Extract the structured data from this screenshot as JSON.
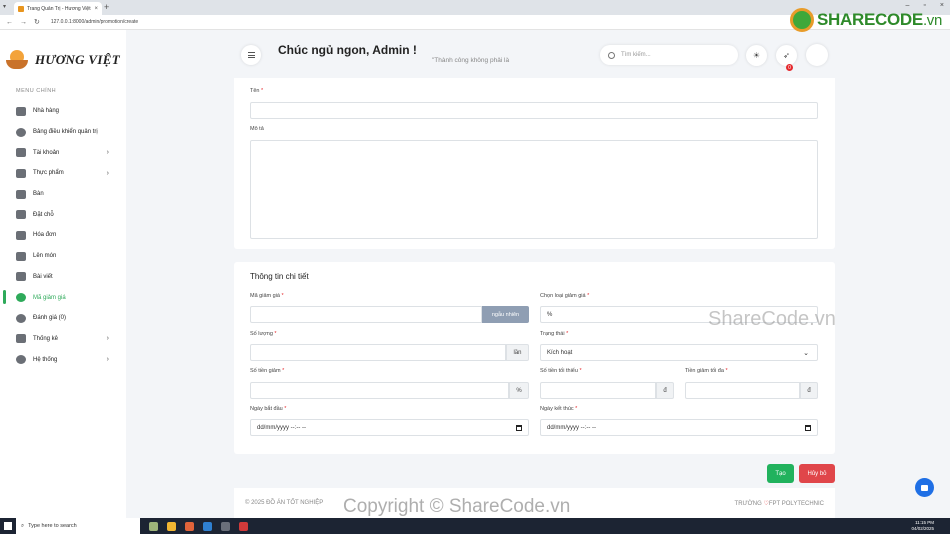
{
  "browser": {
    "tab_title": "Trang Quản Trị - Hương Việt",
    "url": "127.0.0.1:8000/admin/promotion/create"
  },
  "sidebar": {
    "logo_text": "HƯƠNG VIỆT",
    "menu_title": "MENU CHÍNH",
    "items": [
      {
        "label": "Nhà hàng",
        "icon": "store-icon"
      },
      {
        "label": "Bảng điều khiển quản trị",
        "icon": "dashboard-icon"
      },
      {
        "label": "Tài khoản",
        "icon": "users-icon",
        "has_children": true
      },
      {
        "label": "Thực phẩm",
        "icon": "utensils-icon",
        "has_children": true
      },
      {
        "label": "Bàn",
        "icon": "table-icon"
      },
      {
        "label": "Đặt chỗ",
        "icon": "calendar-icon"
      },
      {
        "label": "Hóa đơn",
        "icon": "invoice-icon"
      },
      {
        "label": "Lên món",
        "icon": "serve-icon"
      },
      {
        "label": "Bài viết",
        "icon": "newspaper-icon"
      },
      {
        "label": "Mã giảm giá",
        "icon": "ticket-icon",
        "active": true
      },
      {
        "label": "Đánh giá (0)",
        "icon": "comments-icon"
      },
      {
        "label": "Thống kê",
        "icon": "chart-icon",
        "has_children": true
      },
      {
        "label": "Hệ thống",
        "icon": "cogs-icon",
        "has_children": true
      }
    ],
    "active_color": "#2eaa5a"
  },
  "header": {
    "greeting": "Chúc ngủ ngon, Admin !",
    "quote": "\"Thành công không phải là",
    "search_placeholder": "Tìm kiếm...",
    "notification_count": "0"
  },
  "form": {
    "name_label": "Tên",
    "name_value": "",
    "description_label": "Mô tả",
    "description_value": "",
    "detail_title": "Thông tin chi tiết",
    "code_label": "Mã giảm giá",
    "code_value": "",
    "generate_label": "ngẫu nhiên",
    "discount_type_label": "Chọn loại giảm giá",
    "discount_type_value": "%",
    "quantity_label": "Số lượng",
    "quantity_unit": "lần",
    "status_label": "Trạng thái",
    "status_value": "Kích hoạt",
    "amount_label": "Số tiền giảm",
    "amount_unit": "%",
    "min_amount_label": "Số tiền tối thiểu",
    "min_amount_unit": "đ",
    "max_discount_label": "Tiền giảm tối đa",
    "max_discount_unit": "đ",
    "start_label": "Ngày bắt đầu",
    "start_placeholder": "dd/mm/yyyy --:-- --",
    "end_label": "Ngày kết thúc",
    "end_placeholder": "dd/mm/yyyy --:-- --",
    "required_mark": "*"
  },
  "actions": {
    "save_label": "Tạo",
    "cancel_label": "Hủy bỏ",
    "save_color": "#21b25d",
    "cancel_color": "#e0464a"
  },
  "footer": {
    "left": "© 2025 ĐỒ ÁN TỐT NGHIỆP",
    "right_prefix": "TRƯỜNG",
    "right_suffix": "FPT POLYTECHNIC"
  },
  "watermarks": {
    "logo_main": "SHARECODE",
    "logo_suffix": ".vn",
    "middle": "ShareCode.vn",
    "bottom": "Copyright © ShareCode.vn"
  },
  "taskbar": {
    "search_placeholder": "Type here to search",
    "time": "11:15 PM",
    "date": "04/02/2025"
  }
}
